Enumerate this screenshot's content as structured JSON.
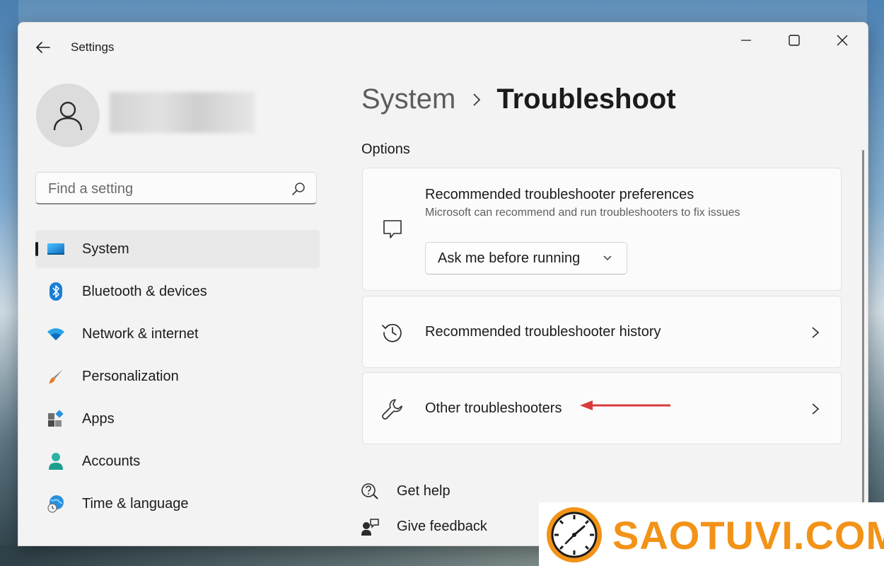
{
  "window": {
    "app_title": "Settings",
    "controls": {
      "minimize": "minimize-icon",
      "maximize": "maximize-icon",
      "close": "close-icon"
    }
  },
  "profile": {
    "avatar_icon": "person-icon"
  },
  "search": {
    "placeholder": "Find a setting",
    "value": ""
  },
  "nav": {
    "active": "System",
    "items": [
      {
        "label": "System",
        "icon": "monitor-icon",
        "active": true
      },
      {
        "label": "Bluetooth & devices",
        "icon": "bluetooth-icon",
        "active": false
      },
      {
        "label": "Network & internet",
        "icon": "wifi-icon",
        "active": false
      },
      {
        "label": "Personalization",
        "icon": "brush-icon",
        "active": false
      },
      {
        "label": "Apps",
        "icon": "apps-icon",
        "active": false
      },
      {
        "label": "Accounts",
        "icon": "person-icon",
        "active": false
      },
      {
        "label": "Time & language",
        "icon": "globe-clock-icon",
        "active": false
      }
    ]
  },
  "content": {
    "breadcrumb": {
      "parent": "System",
      "current": "Troubleshoot"
    },
    "section_title": "Options",
    "cards": {
      "preferences": {
        "title": "Recommended troubleshooter preferences",
        "subtitle": "Microsoft can recommend and run troubleshooters to fix issues",
        "dropdown_value": "Ask me before running",
        "icon": "chat-bubble-icon"
      },
      "history": {
        "title": "Recommended troubleshooter history",
        "icon": "history-icon"
      },
      "other": {
        "title": "Other troubleshooters",
        "icon": "wrench-icon"
      }
    },
    "links": {
      "help": "Get help",
      "feedback": "Give feedback"
    }
  },
  "watermark": {
    "text": "SAOTUVI.COM",
    "color": "#f29318"
  },
  "colors": {
    "window_bg": "#f3f3f3",
    "card_bg": "#fbfbfb",
    "annotation_arrow": "#d93b3b"
  }
}
